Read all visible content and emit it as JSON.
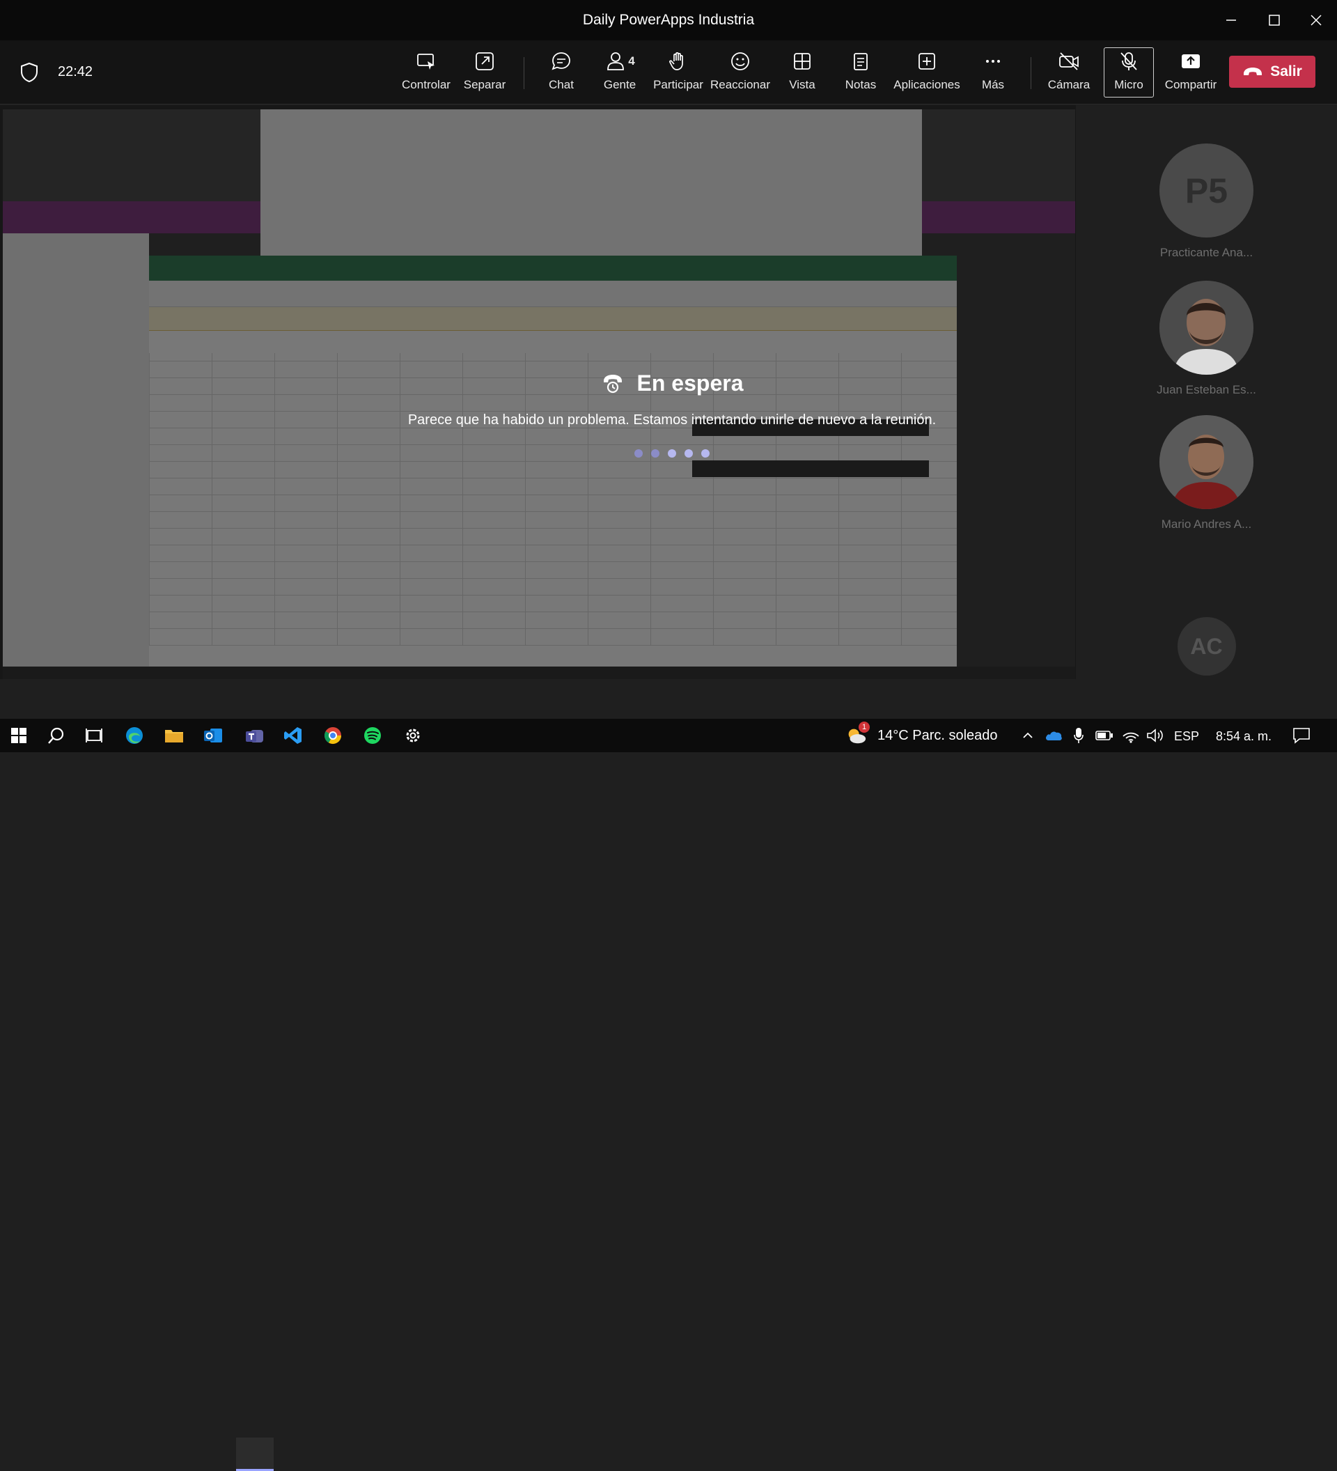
{
  "window": {
    "title": "Daily PowerApps Industria"
  },
  "toolbar": {
    "time": "22:42",
    "items": [
      {
        "label": "Controlar",
        "icon": "control-icon"
      },
      {
        "label": "Separar",
        "icon": "popout-icon"
      },
      {
        "label": "Chat",
        "icon": "chat-icon"
      },
      {
        "label": "Gente",
        "icon": "people-icon",
        "count": "4"
      },
      {
        "label": "Participar",
        "icon": "raise-hand-icon"
      },
      {
        "label": "Reaccionar",
        "icon": "smile-icon"
      },
      {
        "label": "Vista",
        "icon": "grid-icon"
      },
      {
        "label": "Notas",
        "icon": "notes-icon"
      },
      {
        "label": "Aplicaciones",
        "icon": "add-app-icon"
      },
      {
        "label": "Más",
        "icon": "more-icon"
      },
      {
        "label": "Cámara",
        "icon": "camera-off-icon"
      },
      {
        "label": "Micro",
        "icon": "mic-off-icon"
      },
      {
        "label": "Compartir",
        "icon": "share-icon"
      }
    ],
    "leave_label": "Salir",
    "leave_color": "#c4314b"
  },
  "status": {
    "title": "En espera",
    "message": "Parece que ha habido un problema. Estamos intentando unirle de nuevo a la reunión."
  },
  "participants": [
    {
      "initials": "P5",
      "name": "Practicante Ana..."
    },
    {
      "initials": "",
      "name": "Juan Esteban Es..."
    },
    {
      "initials": "",
      "name": "Mario Andres A..."
    },
    {
      "initials": "AC",
      "name": ""
    }
  ],
  "taskbar": {
    "weather": "14°C  Parc. soleado",
    "weather_badge": "1",
    "language": "ESP",
    "time": "8:54 a. m."
  }
}
